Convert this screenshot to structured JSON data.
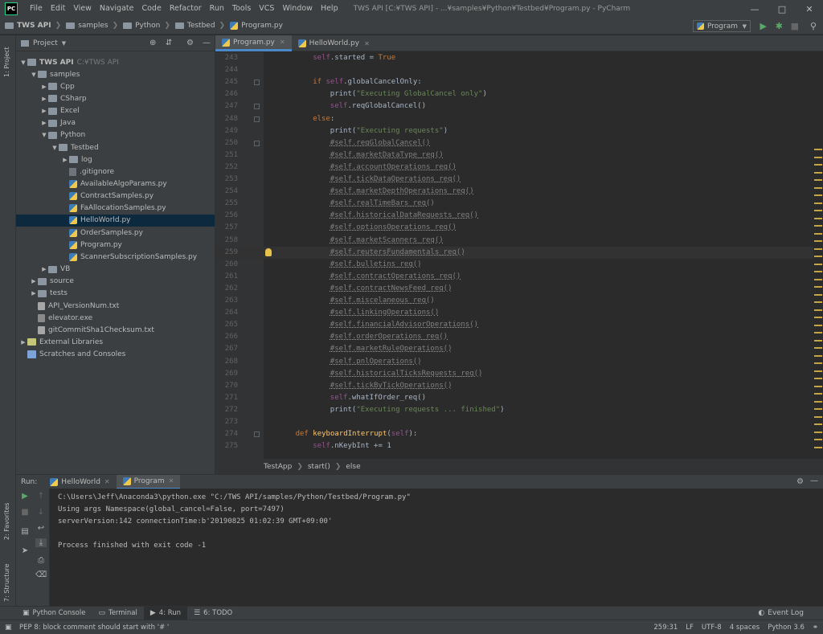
{
  "titlebar": {
    "logo": "PC",
    "menus": [
      "File",
      "Edit",
      "View",
      "Navigate",
      "Code",
      "Refactor",
      "Run",
      "Tools",
      "VCS",
      "Window",
      "Help"
    ],
    "title": "TWS API [C:¥TWS API] - ...¥samples¥Python¥Testbed¥Program.py - PyCharm"
  },
  "navbar": {
    "crumbs": [
      "TWS API",
      "samples",
      "Python",
      "Testbed",
      "Program.py"
    ],
    "run_config": "Program"
  },
  "left_strip": {
    "project": "1: Project",
    "favorites": "2: Favorites",
    "structure": "7: Structure"
  },
  "project": {
    "header": "Project",
    "tree": [
      {
        "label": "TWS API",
        "hint": "C:¥TWS API",
        "depth": 0,
        "expand": "open",
        "icon": "folder"
      },
      {
        "label": "samples",
        "depth": 1,
        "expand": "open",
        "icon": "folder"
      },
      {
        "label": "Cpp",
        "depth": 2,
        "expand": "closed",
        "icon": "folder"
      },
      {
        "label": "CSharp",
        "depth": 2,
        "expand": "closed",
        "icon": "folder"
      },
      {
        "label": "Excel",
        "depth": 2,
        "expand": "closed",
        "icon": "folder"
      },
      {
        "label": "Java",
        "depth": 2,
        "expand": "closed",
        "icon": "folder"
      },
      {
        "label": "Python",
        "depth": 2,
        "expand": "open",
        "icon": "folder"
      },
      {
        "label": "Testbed",
        "depth": 3,
        "expand": "open",
        "icon": "folder"
      },
      {
        "label": "log",
        "depth": 4,
        "expand": "closed",
        "icon": "folder"
      },
      {
        "label": ".gitignore",
        "depth": 4,
        "expand": "none",
        "icon": "git"
      },
      {
        "label": "AvailableAlgoParams.py",
        "depth": 4,
        "expand": "none",
        "icon": "py"
      },
      {
        "label": "ContractSamples.py",
        "depth": 4,
        "expand": "none",
        "icon": "py"
      },
      {
        "label": "FaAllocationSamples.py",
        "depth": 4,
        "expand": "none",
        "icon": "py"
      },
      {
        "label": "HelloWorld.py",
        "depth": 4,
        "expand": "none",
        "icon": "py",
        "selected": true
      },
      {
        "label": "OrderSamples.py",
        "depth": 4,
        "expand": "none",
        "icon": "py"
      },
      {
        "label": "Program.py",
        "depth": 4,
        "expand": "none",
        "icon": "py"
      },
      {
        "label": "ScannerSubscriptionSamples.py",
        "depth": 4,
        "expand": "none",
        "icon": "py"
      },
      {
        "label": "VB",
        "depth": 2,
        "expand": "closed",
        "icon": "folder"
      },
      {
        "label": "source",
        "depth": 1,
        "expand": "closed",
        "icon": "folder"
      },
      {
        "label": "tests",
        "depth": 1,
        "expand": "closed",
        "icon": "folder"
      },
      {
        "label": "API_VersionNum.txt",
        "depth": 1,
        "expand": "none",
        "icon": "txt"
      },
      {
        "label": "elevator.exe",
        "depth": 1,
        "expand": "none",
        "icon": "exe"
      },
      {
        "label": "gitCommitSha1Checksum.txt",
        "depth": 1,
        "expand": "none",
        "icon": "txt"
      },
      {
        "label": "External Libraries",
        "depth": 0,
        "expand": "closed",
        "icon": "lib"
      },
      {
        "label": "Scratches and Consoles",
        "depth": 0,
        "expand": "none",
        "icon": "scratch"
      }
    ]
  },
  "editor": {
    "tabs": [
      {
        "label": "Program.py",
        "active": true
      },
      {
        "label": "HelloWorld.py",
        "active": false
      }
    ],
    "current_line": 259,
    "lines": [
      {
        "n": 243,
        "indent": 8,
        "t": [
          [
            "self",
            "self"
          ],
          [
            "ident",
            ".started = "
          ],
          [
            "kw",
            "True"
          ]
        ]
      },
      {
        "n": 244,
        "indent": 0,
        "t": []
      },
      {
        "n": 245,
        "indent": 8,
        "fold": true,
        "t": [
          [
            "kw",
            "if "
          ],
          [
            "self",
            "self"
          ],
          [
            "ident",
            ".globalCancelOnly:"
          ]
        ]
      },
      {
        "n": 246,
        "indent": 12,
        "t": [
          [
            "ident",
            "print("
          ],
          [
            "str",
            "\"Executing GlobalCancel only\""
          ],
          [
            "ident",
            ")"
          ]
        ]
      },
      {
        "n": 247,
        "indent": 12,
        "fold": true,
        "t": [
          [
            "self",
            "self"
          ],
          [
            "ident",
            ".reqGlobalCancel()"
          ]
        ]
      },
      {
        "n": 248,
        "indent": 8,
        "fold": true,
        "t": [
          [
            "kw",
            "else"
          ],
          [
            "ident",
            ":"
          ]
        ]
      },
      {
        "n": 249,
        "indent": 12,
        "t": [
          [
            "ident",
            "print("
          ],
          [
            "str",
            "\"Executing requests\""
          ],
          [
            "ident",
            ")"
          ]
        ]
      },
      {
        "n": 250,
        "indent": 12,
        "fold": true,
        "t": [
          [
            "cmt",
            "#self.reqGlobalCancel()"
          ]
        ]
      },
      {
        "n": 251,
        "indent": 12,
        "t": [
          [
            "cmt",
            "#self.marketDataType_req()"
          ]
        ]
      },
      {
        "n": 252,
        "indent": 12,
        "t": [
          [
            "cmt",
            "#self.accountOperations_req()"
          ]
        ]
      },
      {
        "n": 253,
        "indent": 12,
        "t": [
          [
            "cmt",
            "#self.tickDataOperations_req()"
          ]
        ]
      },
      {
        "n": 254,
        "indent": 12,
        "t": [
          [
            "cmt",
            "#self.marketDepthOperations_req()"
          ]
        ]
      },
      {
        "n": 255,
        "indent": 12,
        "t": [
          [
            "cmt",
            "#self.realTimeBars_req()"
          ]
        ]
      },
      {
        "n": 256,
        "indent": 12,
        "t": [
          [
            "cmt",
            "#self.historicalDataRequests_req()"
          ]
        ]
      },
      {
        "n": 257,
        "indent": 12,
        "t": [
          [
            "cmt",
            "#self.optionsOperations_req()"
          ]
        ]
      },
      {
        "n": 258,
        "indent": 12,
        "t": [
          [
            "cmt",
            "#self.marketScanners_req()"
          ]
        ]
      },
      {
        "n": 259,
        "indent": 12,
        "t": [
          [
            "cmt",
            "#self.reutersFundamentals_req()"
          ]
        ]
      },
      {
        "n": 260,
        "indent": 12,
        "t": [
          [
            "cmt",
            "#self.bulletins_req()"
          ]
        ]
      },
      {
        "n": 261,
        "indent": 12,
        "t": [
          [
            "cmt",
            "#self.contractOperations_req()"
          ]
        ]
      },
      {
        "n": 262,
        "indent": 12,
        "t": [
          [
            "cmt",
            "#self.contractNewsFeed_req()"
          ]
        ]
      },
      {
        "n": 263,
        "indent": 12,
        "t": [
          [
            "cmt",
            "#self.miscelaneous_req()"
          ]
        ]
      },
      {
        "n": 264,
        "indent": 12,
        "t": [
          [
            "cmt",
            "#self.linkingOperations()"
          ]
        ]
      },
      {
        "n": 265,
        "indent": 12,
        "t": [
          [
            "cmt",
            "#self.financialAdvisorOperations()"
          ]
        ]
      },
      {
        "n": 266,
        "indent": 12,
        "t": [
          [
            "cmt",
            "#self.orderOperations_req()"
          ]
        ]
      },
      {
        "n": 267,
        "indent": 12,
        "t": [
          [
            "cmt",
            "#self.marketRuleOperations()"
          ]
        ]
      },
      {
        "n": 268,
        "indent": 12,
        "t": [
          [
            "cmt",
            "#self.pnlOperations()"
          ]
        ]
      },
      {
        "n": 269,
        "indent": 12,
        "t": [
          [
            "cmt",
            "#self.historicalTicksRequests_req()"
          ]
        ]
      },
      {
        "n": 270,
        "indent": 12,
        "t": [
          [
            "cmt",
            "#self.tickByTickOperations()"
          ]
        ]
      },
      {
        "n": 271,
        "indent": 12,
        "t": [
          [
            "self",
            "self"
          ],
          [
            "ident",
            ".whatIfOrder_req()"
          ]
        ]
      },
      {
        "n": 272,
        "indent": 12,
        "t": [
          [
            "ident",
            "print("
          ],
          [
            "str",
            "\"Executing requests ... finished\""
          ],
          [
            "ident",
            ")"
          ]
        ]
      },
      {
        "n": 273,
        "indent": 0,
        "t": []
      },
      {
        "n": 274,
        "indent": 4,
        "fold": true,
        "t": [
          [
            "kw",
            "def "
          ],
          [
            "fn",
            "keyboardInterrupt"
          ],
          [
            "ident",
            "("
          ],
          [
            "self",
            "self"
          ],
          [
            "ident",
            "):"
          ]
        ]
      },
      {
        "n": 275,
        "indent": 8,
        "t": [
          [
            "self",
            "self"
          ],
          [
            "ident",
            ".nKeybInt += "
          ],
          [
            "ident",
            "1"
          ]
        ]
      }
    ],
    "breadcrumb": [
      "TestApp",
      "start()",
      "else"
    ]
  },
  "run": {
    "label": "Run:",
    "tabs": [
      {
        "label": "HelloWorld",
        "active": false
      },
      {
        "label": "Program",
        "active": true
      }
    ],
    "console": [
      "C:\\Users\\Jeff\\Anaconda3\\python.exe \"C:/TWS API/samples/Python/Testbed/Program.py\"",
      "Using args Namespace(global_cancel=False, port=7497)",
      "serverVersion:142 connectionTime:b'20190825 01:02:39 GMT+09:00'",
      "",
      "Process finished with exit code -1"
    ]
  },
  "toolwindows": [
    {
      "label": "Python Console",
      "icon": "python-console-icon",
      "glyph": "▣"
    },
    {
      "label": "Terminal",
      "icon": "terminal-icon",
      "glyph": "▭"
    },
    {
      "label": "4: Run",
      "icon": "run-icon",
      "glyph": "▶",
      "active": true
    },
    {
      "label": "6: TODO",
      "icon": "todo-icon",
      "glyph": "☰"
    }
  ],
  "event_log": "Event Log",
  "status": {
    "message": "PEP 8: block comment should start with '# '",
    "position": "259:31",
    "line_sep": "LF",
    "encoding": "UTF-8",
    "indent": "4 spaces",
    "interpreter": "Python 3.6"
  }
}
